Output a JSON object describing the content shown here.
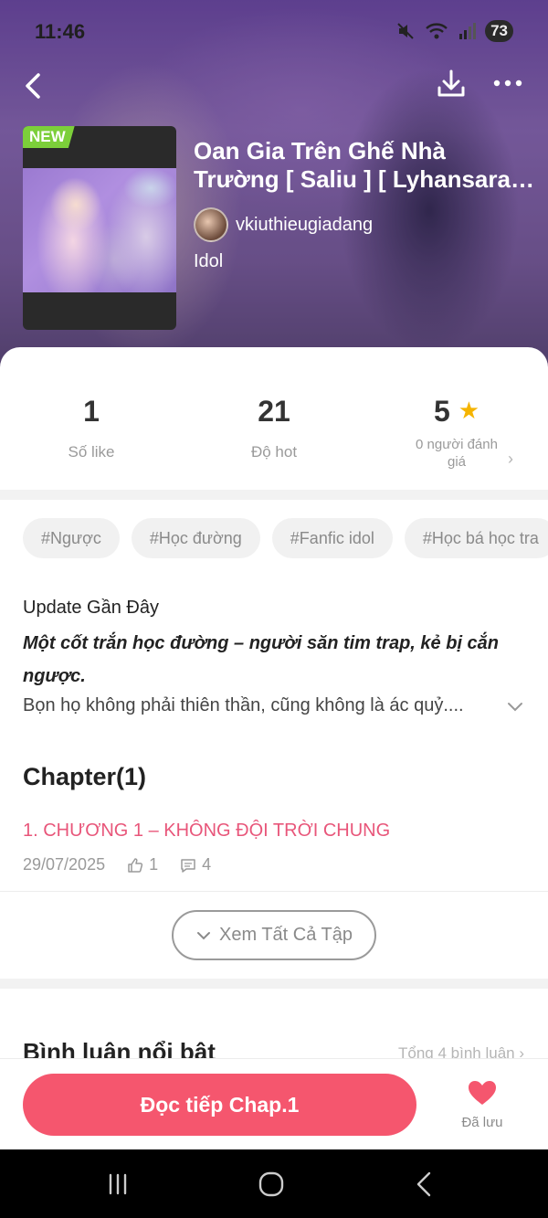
{
  "status": {
    "time": "11:46",
    "battery": "73"
  },
  "header": {
    "badge": "NEW",
    "title_line1": "Oan Gia Trên Ghế Nhà",
    "title_line2": "Trường [ Saliu ] [ Lyhansara ...",
    "author": "vkiuthieugiadang",
    "genre": "Idol"
  },
  "stats": {
    "likes": {
      "value": "1",
      "label": "Số like"
    },
    "hot": {
      "value": "21",
      "label": "Độ hot"
    },
    "rating": {
      "value": "5",
      "label": "0 người đánh giá"
    }
  },
  "tags": [
    "#Ngược",
    "#Học đường",
    "#Fanfic idol",
    "#Học bá học tra"
  ],
  "description": {
    "heading": "Update Gần Đây",
    "bold_text": "Một cốt trắn học đường – người săn tim trap, kẻ bị cắn ngược.",
    "body": "Bọn họ không phải thiên thần, cũng không là ác quỷ...."
  },
  "chapters": {
    "heading": "Chapter(1)",
    "items": [
      {
        "title": "1. CHƯƠNG 1 – KHÔNG ĐỘI TRỜI CHUNG",
        "date": "29/07/2025",
        "likes": "1",
        "comments": "4"
      }
    ],
    "see_all": "Xem Tất Cả Tập"
  },
  "comments": {
    "heading": "Bình luận nổi bật",
    "total": "Tổng 4 bình luận"
  },
  "bottom": {
    "read_button": "Đọc tiếp Chap.1",
    "saved_label": "Đã lưu"
  },
  "colors": {
    "accent": "#f5566e",
    "chapter_link": "#e8567a",
    "new_badge": "#7ccf3a",
    "star": "#f5b400"
  },
  "icons": [
    "back-icon",
    "download-icon",
    "more-icon",
    "star-icon",
    "chevron-right-icon",
    "chevron-down-icon",
    "thumbs-up-icon",
    "comment-icon",
    "heart-icon",
    "recent-apps-icon",
    "home-icon",
    "system-back-icon"
  ]
}
